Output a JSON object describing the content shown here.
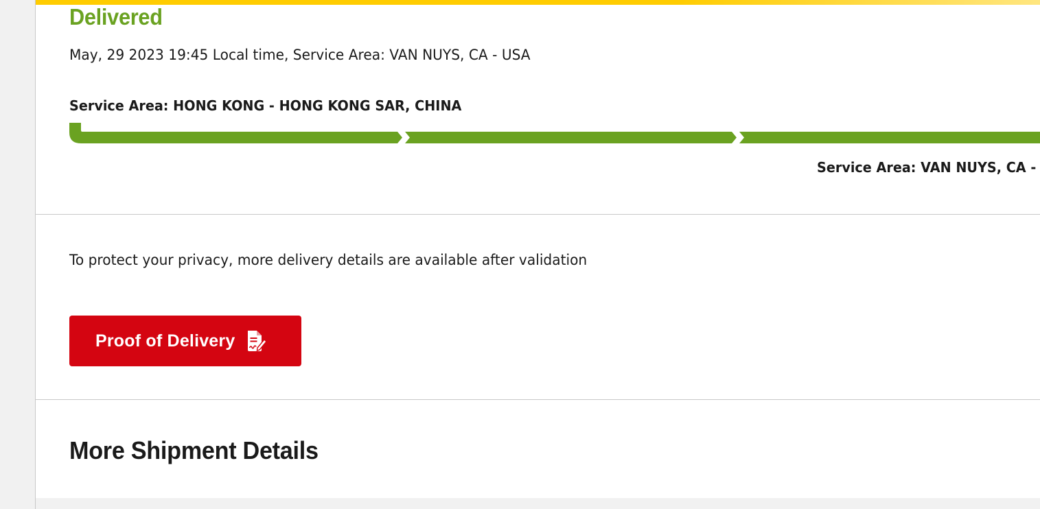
{
  "status": {
    "title": "Delivered",
    "detail": "May, 29 2023 19:45 Local time, Service Area: VAN NUYS, CA - USA",
    "color": "#6aa221"
  },
  "route": {
    "origin": "Service Area: HONG KONG - HONG KONG SAR, CHINA",
    "destination": "Service Area: VAN NUYS, CA -",
    "progress_fraction": 1.0,
    "segments_visible": 3
  },
  "privacy": {
    "note": "To protect your privacy, more delivery details are available after validation"
  },
  "proof_button": {
    "label": "Proof of Delivery",
    "icon": "signed-document-icon",
    "color": "#d40511"
  },
  "more_details": {
    "heading": "More Shipment Details"
  },
  "colors": {
    "brand_yellow": "#ffcc00",
    "divider": "#c8c8c8",
    "text": "#1a1a1a"
  }
}
